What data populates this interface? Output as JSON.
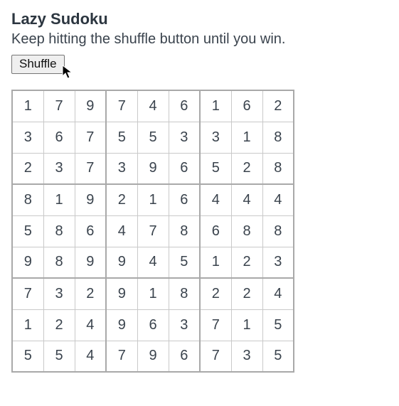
{
  "title": "Lazy Sudoku",
  "subtitle": "Keep hitting the shuffle button until you win.",
  "shuffle_label": "Shuffle",
  "grid": [
    [
      1,
      7,
      9,
      7,
      4,
      6,
      1,
      6,
      2
    ],
    [
      3,
      6,
      7,
      5,
      5,
      3,
      3,
      1,
      8
    ],
    [
      2,
      3,
      7,
      3,
      9,
      6,
      5,
      2,
      8
    ],
    [
      8,
      1,
      9,
      2,
      1,
      6,
      4,
      4,
      4
    ],
    [
      5,
      8,
      6,
      4,
      7,
      8,
      6,
      8,
      8
    ],
    [
      9,
      8,
      9,
      9,
      4,
      5,
      1,
      2,
      3
    ],
    [
      7,
      3,
      2,
      9,
      1,
      8,
      2,
      2,
      4
    ],
    [
      1,
      2,
      4,
      9,
      6,
      3,
      7,
      1,
      5
    ],
    [
      5,
      5,
      4,
      7,
      9,
      6,
      7,
      3,
      5
    ]
  ]
}
